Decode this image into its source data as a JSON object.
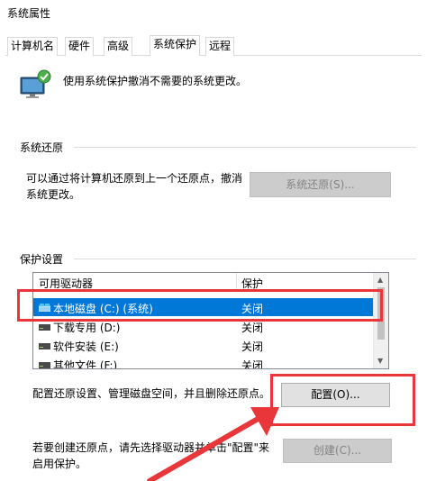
{
  "window": {
    "title": "系统属性"
  },
  "tabs": [
    {
      "label": "计算机名"
    },
    {
      "label": "硬件"
    },
    {
      "label": "高级"
    },
    {
      "label": "系统保护",
      "active": true
    },
    {
      "label": "远程"
    }
  ],
  "intro": {
    "text": "使用系统保护撤消不需要的系统更改。",
    "icon": "system-shield-monitor-icon"
  },
  "restore": {
    "section_label": "系统还原",
    "desc_line1": "可以通过将计算机还原到上一个还原点，撤消",
    "desc_line2": "系统更改。",
    "button_label": "系统还原(S)..."
  },
  "protection": {
    "section_label": "保护设置",
    "columns": {
      "drive": "可用驱动器",
      "protection": "保护"
    },
    "rows": [
      {
        "name": "本地磁盘 (C:) (系统)",
        "status": "关闭",
        "selected": true
      },
      {
        "name": "下载专用 (D:)",
        "status": "关闭"
      },
      {
        "name": "软件安装 (E:)",
        "status": "关闭"
      },
      {
        "name": "其他文件 (F:)",
        "status": "关闭"
      }
    ],
    "configure_text": "配置还原设置、管理磁盘空间，并且删除还原点。",
    "configure_button": "配置(O)...",
    "create_line1": "若要创建还原点，请先选择驱动器并单击\"配置\"来",
    "create_line2": "启用保护。",
    "create_button": "创建(C)..."
  },
  "colors": {
    "selection": "#0078d7",
    "annotation_red": "#e8363a",
    "disabled_text": "#838383"
  }
}
